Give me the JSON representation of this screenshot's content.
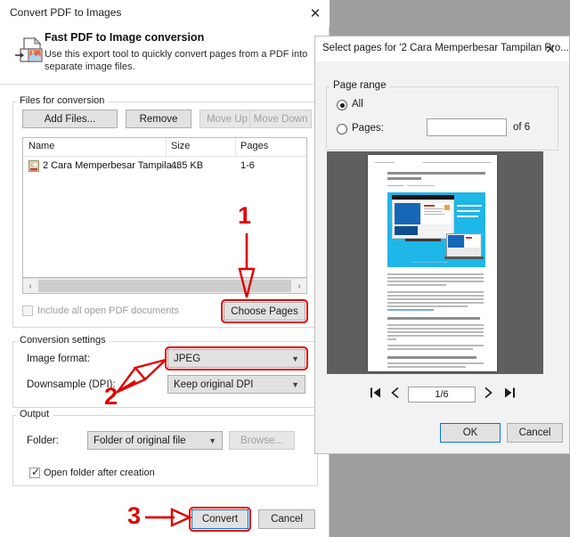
{
  "background_color": "#9e9e9e",
  "main_dialog": {
    "title": "Convert PDF to Images",
    "close_icon": "✕",
    "header": {
      "icon": "pdf-to-image-icon",
      "title": "Fast PDF to Image conversion",
      "description": "Use this export tool to quickly convert pages from a PDF into separate image files."
    },
    "files_group": {
      "label": "Files for conversion",
      "buttons": [
        {
          "label": "Add Files...",
          "enabled": true
        },
        {
          "label": "Remove",
          "enabled": true
        },
        {
          "label": "Move Up",
          "enabled": false
        },
        {
          "label": "Move Down",
          "enabled": false
        }
      ],
      "columns": [
        "Name",
        "Size",
        "Pages"
      ],
      "rows": [
        {
          "icon": "pdf-file-icon",
          "name": "2 Cara Memperbesar Tampila...",
          "size": "485 KB",
          "pages": "1-6"
        }
      ],
      "scroll_left_arrow": "‹",
      "scroll_right_arrow": "›",
      "include_all_checkbox": {
        "label": "Include all open PDF documents",
        "checked": false,
        "enabled": false
      },
      "choose_pages_button": "Choose Pages"
    },
    "conversion_group": {
      "label": "Conversion settings",
      "image_format": {
        "label": "Image format:",
        "value": "JPEG"
      },
      "downsample": {
        "label": "Downsample (DPI):",
        "value": "Keep original DPI"
      }
    },
    "output_group": {
      "label": "Output",
      "folder": {
        "label": "Folder:",
        "value": "Folder of original file"
      },
      "browse_button": {
        "label": "Browse...",
        "enabled": false
      },
      "open_folder_checkbox": {
        "label": "Open folder after creation",
        "checked": true
      }
    },
    "footer": {
      "convert_button": "Convert",
      "cancel_button": "Cancel"
    }
  },
  "pages_dialog": {
    "title": "Select pages for '2 Cara Memperbesar Tampilan Pro...",
    "close_icon": "✕",
    "page_range": {
      "label": "Page range",
      "all_option": "All",
      "pages_option": "Pages:",
      "selected": "All",
      "pages_input_value": "",
      "of_label": "of 6"
    },
    "preview": {
      "doc_title": "2 Cara Memperbesar Tampilan Projektor di Laptop Windows",
      "heading_2": "Cara Memperbesar Tampilan Projektor di Laptop Windows 10/8/7",
      "heading_3": "Memperbesar Tampilan pada Proyektor di Windows 7 dan Windows 8/8.1",
      "heading_4": "1. Mengubah Screen Resolution pada Windows 7 dan Windows 8/8.1"
    },
    "navigation": {
      "first_icon": "⏮",
      "prev_icon": "‹",
      "indicator": "1/6",
      "next_icon": "›",
      "last_icon": "⏭"
    },
    "footer": {
      "ok_button": "OK",
      "cancel_button": "Cancel"
    }
  },
  "annotations": {
    "accent_color": "#e00000",
    "steps": [
      {
        "number": "1",
        "target": "Choose Pages"
      },
      {
        "number": "2",
        "target": "Image format JPEG"
      },
      {
        "number": "3",
        "target": "Convert"
      }
    ]
  }
}
